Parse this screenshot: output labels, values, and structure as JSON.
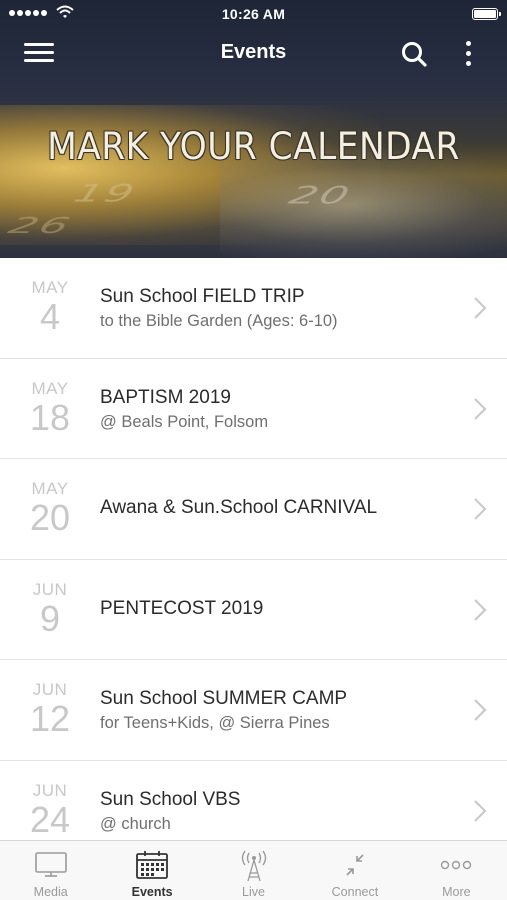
{
  "status": {
    "time": "10:26 AM",
    "signal_icon": "signal-dots-icon",
    "wifi_icon": "wifi-icon",
    "battery_icon": "battery-icon"
  },
  "header": {
    "title": "Events",
    "menu_icon": "hamburger-menu-icon",
    "search_icon": "search-icon",
    "more_icon": "kebab-more-icon"
  },
  "hero": {
    "title": "MARK YOUR CALENDAR",
    "calendar_numbers": [
      "19",
      "20",
      "26"
    ]
  },
  "events": [
    {
      "month": "MAY",
      "day": "4",
      "title": "Sun School FIELD TRIP",
      "subtitle": "to the Bible Garden (Ages: 6-10)"
    },
    {
      "month": "MAY",
      "day": "18",
      "title": "BAPTISM 2019",
      "subtitle": "@ Beals Point, Folsom"
    },
    {
      "month": "MAY",
      "day": "20",
      "title": "Awana & Sun.School CARNIVAL",
      "subtitle": ""
    },
    {
      "month": "JUN",
      "day": "9",
      "title": "PENTECOST 2019",
      "subtitle": ""
    },
    {
      "month": "JUN",
      "day": "12",
      "title": "Sun School SUMMER CAMP",
      "subtitle": "for Teens+Kids, @ Sierra Pines"
    },
    {
      "month": "JUN",
      "day": "24",
      "title": "Sun School VBS",
      "subtitle": "@ church"
    }
  ],
  "tabs": [
    {
      "label": "Media",
      "icon": "tv-monitor-icon",
      "active": false
    },
    {
      "label": "Events",
      "icon": "calendar-icon",
      "active": true
    },
    {
      "label": "Live",
      "icon": "broadcast-tower-icon",
      "active": false
    },
    {
      "label": "Connect",
      "icon": "collapse-arrows-icon",
      "active": false
    },
    {
      "label": "More",
      "icon": "more-dots-icon",
      "active": false
    }
  ],
  "colors": {
    "header_bg": "#1d2536",
    "hero_gold": "#e8c462",
    "date_gray": "#c8c8c8",
    "active_tab": "#333333",
    "inactive_tab": "#9a9a9a"
  }
}
